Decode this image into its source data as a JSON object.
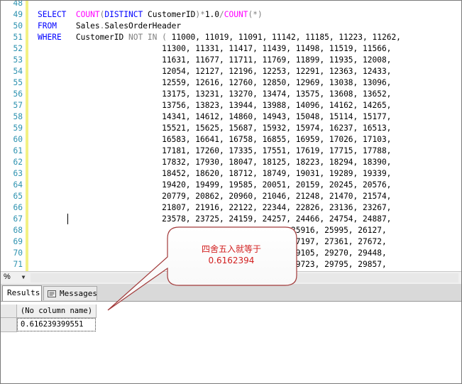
{
  "editor": {
    "lines": [
      {
        "num": "48",
        "parts": []
      },
      {
        "num": "49",
        "parts": [
          {
            "t": "SELECT",
            "c": "kw"
          },
          {
            "t": "  "
          },
          {
            "t": "COUNT",
            "c": "fn"
          },
          {
            "t": "(",
            "c": "gr"
          },
          {
            "t": "DISTINCT",
            "c": "kw"
          },
          {
            "t": " CustomerID"
          },
          {
            "t": ")*",
            "c": "gr"
          },
          {
            "t": "1.0"
          },
          {
            "t": "/",
            "c": "gr"
          },
          {
            "t": "COUNT",
            "c": "fn"
          },
          {
            "t": "(*)",
            "c": "gr"
          }
        ]
      },
      {
        "num": "50",
        "parts": [
          {
            "t": "FROM",
            "c": "kw"
          },
          {
            "t": "    Sales"
          },
          {
            "t": ".",
            "c": "gr"
          },
          {
            "t": "SalesOrderHeader"
          }
        ]
      },
      {
        "num": "51",
        "parts": [
          {
            "t": "WHERE",
            "c": "kw"
          },
          {
            "t": "   CustomerID "
          },
          {
            "t": "NOT IN (",
            "c": "gr"
          },
          {
            "t": " 11000, 11019, 11091, 11142, 11185, 11223, 11262,"
          }
        ]
      },
      {
        "num": "52",
        "parts": [
          {
            "t": "                          11300, 11331, 11417, 11439, 11498, 11519, 11566,"
          }
        ]
      },
      {
        "num": "53",
        "parts": [
          {
            "t": "                          11631, 11677, 11711, 11769, 11899, 11935, 12008,"
          }
        ]
      },
      {
        "num": "54",
        "parts": [
          {
            "t": "                          12054, 12127, 12196, 12253, 12291, 12363, 12433,"
          }
        ]
      },
      {
        "num": "55",
        "parts": [
          {
            "t": "                          12559, 12616, 12760, 12850, 12969, 13038, 13096,"
          }
        ]
      },
      {
        "num": "56",
        "parts": [
          {
            "t": "                          13175, 13231, 13270, 13474, 13575, 13608, 13652,"
          }
        ]
      },
      {
        "num": "57",
        "parts": [
          {
            "t": "                          13756, 13823, 13944, 13988, 14096, 14162, 14265,"
          }
        ]
      },
      {
        "num": "58",
        "parts": [
          {
            "t": "                          14341, 14612, 14860, 14943, 15048, 15114, 15177,"
          }
        ]
      },
      {
        "num": "59",
        "parts": [
          {
            "t": "                          15521, 15625, 15687, 15932, 15974, 16237, 16513,"
          }
        ]
      },
      {
        "num": "60",
        "parts": [
          {
            "t": "                          16583, 16641, 16758, 16855, 16959, 17026, 17103,"
          }
        ]
      },
      {
        "num": "61",
        "parts": [
          {
            "t": "                          17181, 17260, 17335, 17551, 17619, 17715, 17788,"
          }
        ]
      },
      {
        "num": "62",
        "parts": [
          {
            "t": "                          17832, 17930, 18047, 18125, 18223, 18294, 18390,"
          }
        ]
      },
      {
        "num": "63",
        "parts": [
          {
            "t": "                          18452, 18620, 18712, 18749, 19031, 19289, 19339,"
          }
        ]
      },
      {
        "num": "64",
        "parts": [
          {
            "t": "                          19420, 19499, 19585, 20051, 20159, 20245, 20576,"
          }
        ]
      },
      {
        "num": "65",
        "parts": [
          {
            "t": "                          20779, 20862, 20960, 21046, 21248, 21470, 21574,"
          }
        ]
      },
      {
        "num": "66",
        "parts": [
          {
            "t": "                          21807, 21916, 22122, 22344, 22826, 23136, 23267,"
          }
        ]
      },
      {
        "num": "67",
        "parts": [
          {
            "t": "                          23578, 23725, 24159, 24257, 24466, 24754, 24887,"
          }
        ]
      },
      {
        "num": "68",
        "parts": [
          {
            "t": "                                              25719, 25916, 25995, 26127,"
          }
        ]
      },
      {
        "num": "69",
        "parts": [
          {
            "t": "                                              27011, 27197, 27361, 27672,"
          }
        ]
      },
      {
        "num": "70",
        "parts": [
          {
            "t": "                                              28919, 29105, 29270, 29448,"
          }
        ]
      },
      {
        "num": "71",
        "parts": [
          {
            "t": "                                              29598, 29723, 29795, 29857,"
          }
        ]
      }
    ]
  },
  "status": {
    "zoom": "%",
    "zoom_arrow": "▼"
  },
  "tabs": {
    "results": "Results",
    "messages": "Messages"
  },
  "grid": {
    "column_header": "(No column name)",
    "rows": [
      {
        "value": "0.616239399551"
      }
    ]
  },
  "callout": {
    "line1": "四舍五入就等于",
    "line2": "0.6162394",
    "color": "#d21f1f"
  },
  "colors": {
    "keyword": "#0000ff",
    "function": "#ff00ff",
    "operator": "#808080",
    "line_number": "#2b91af",
    "change_bar": "#f3f183"
  }
}
